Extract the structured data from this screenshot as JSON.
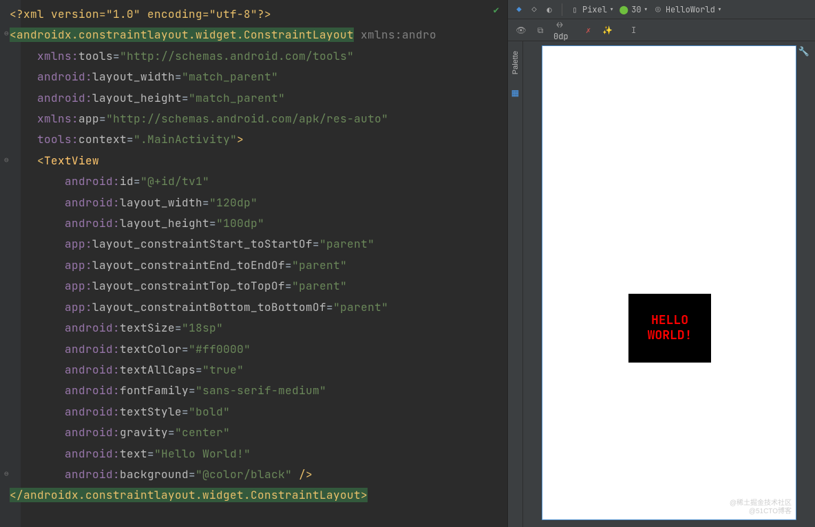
{
  "editor": {
    "xml_decl_open": "<?",
    "xml_decl": "xml version=\"1.0\" encoding=\"utf-8\"",
    "xml_decl_close": "?>",
    "root_open_lt": "<",
    "root_tag": "androidx.constraintlayout.widget.ConstraintLayout",
    "root_xmlns_cut": " xmlns:andro",
    "lines": {
      "l3_ns": "xmlns:",
      "l3_attr": "tools",
      "l3_eq": "=",
      "l3_val": "\"http://schemas.android.com/tools\"",
      "l4_ns": "android:",
      "l4_attr": "layout_width",
      "l4_eq": "=",
      "l4_val": "\"match_parent\"",
      "l5_ns": "android:",
      "l5_attr": "layout_height",
      "l5_eq": "=",
      "l5_val": "\"match_parent\"",
      "l6_ns": "xmlns:",
      "l6_attr": "app",
      "l6_eq": "=",
      "l6_val": "\"http://schemas.android.com/apk/res-auto\"",
      "l7_ns": "tools:",
      "l7_attr": "context",
      "l7_eq": "=",
      "l7_val": "\".MainActivity\"",
      "l7_gt": ">",
      "l8_lt": "<",
      "l8_tag": "TextView",
      "l9_ns": "android:",
      "l9_attr": "id",
      "l9_eq": "=",
      "l9_val": "\"@+id/tv1\"",
      "l10_ns": "android:",
      "l10_attr": "layout_width",
      "l10_eq": "=",
      "l10_val": "\"120dp\"",
      "l11_ns": "android:",
      "l11_attr": "layout_height",
      "l11_eq": "=",
      "l11_val": "\"100dp\"",
      "l12_ns": "app:",
      "l12_attr": "layout_constraintStart_toStartOf",
      "l12_eq": "=",
      "l12_val": "\"parent\"",
      "l13_ns": "app:",
      "l13_attr": "layout_constraintEnd_toEndOf",
      "l13_eq": "=",
      "l13_val": "\"parent\"",
      "l14_ns": "app:",
      "l14_attr": "layout_constraintTop_toTopOf",
      "l14_eq": "=",
      "l14_val": "\"parent\"",
      "l15_ns": "app:",
      "l15_attr": "layout_constraintBottom_toBottomOf",
      "l15_eq": "=",
      "l15_val": "\"parent\"",
      "l16_ns": "android:",
      "l16_attr": "textSize",
      "l16_eq": "=",
      "l16_val": "\"18sp\"",
      "l17_ns": "android:",
      "l17_attr": "textColor",
      "l17_eq": "=",
      "l17_val": "\"#ff0000\"",
      "l18_ns": "android:",
      "l18_attr": "textAllCaps",
      "l18_eq": "=",
      "l18_val": "\"true\"",
      "l19_ns": "android:",
      "l19_attr": "fontFamily",
      "l19_eq": "=",
      "l19_val": "\"sans-serif-medium\"",
      "l20_ns": "android:",
      "l20_attr": "textStyle",
      "l20_eq": "=",
      "l20_val": "\"bold\"",
      "l21_ns": "android:",
      "l21_attr": "gravity",
      "l21_eq": "=",
      "l21_val": "\"center\"",
      "l22_ns": "android:",
      "l22_attr": "text",
      "l22_eq": "=",
      "l22_val": "\"Hello World!\"",
      "l23_ns": "android:",
      "l23_attr": "background",
      "l23_eq": "=",
      "l23_val": "\"@color/black\"",
      "l23_close": " />"
    },
    "close_lt": "</",
    "close_tag": "androidx.constraintlayout.widget.ConstraintLayout",
    "close_gt": ">"
  },
  "toolbar": {
    "device": "Pixel",
    "api": "30",
    "app": "HelloWorld",
    "margin": "0dp",
    "palette": "Palette"
  },
  "preview": {
    "tv_text": "HELLO WORLD!"
  },
  "watermark": "@稀土掘金技术社区",
  "watermark2": "@51CTO博客"
}
